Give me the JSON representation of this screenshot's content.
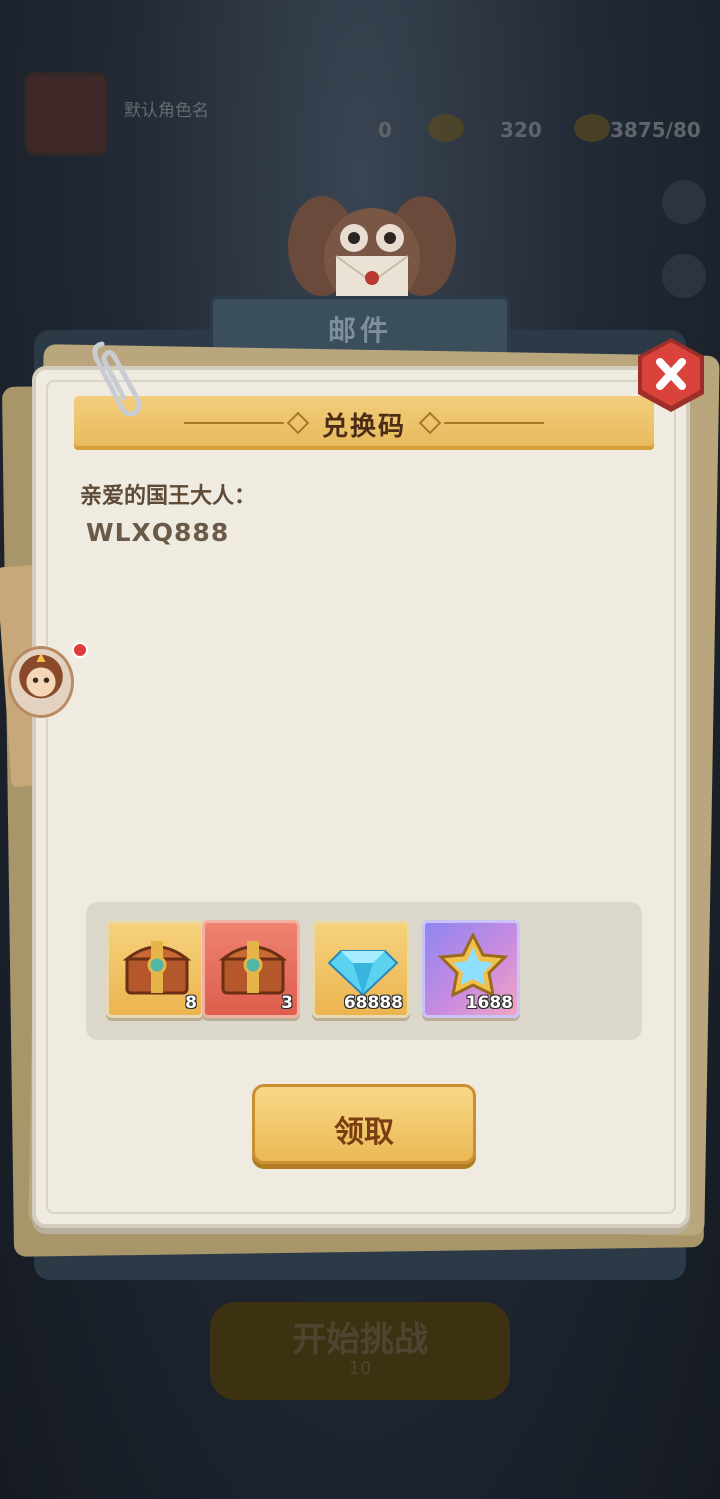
{
  "background": {
    "player_name": "默认角色名",
    "resources": [
      {
        "name": "unknown",
        "value": "0"
      },
      {
        "name": "gold",
        "value": "320"
      },
      {
        "name": "stamina",
        "value": "3875/80"
      }
    ],
    "start_button_label": "开始挑战",
    "start_button_cost": "10"
  },
  "mail": {
    "header_title": "邮件",
    "banner_title": "兑换码",
    "greeting": "亲爱的国王大人：",
    "code": "WLXQ888",
    "rewards": [
      {
        "icon": "treasure-chest-icon",
        "style": "orange",
        "count": "8"
      },
      {
        "icon": "treasure-chest-icon",
        "style": "red",
        "count": "3"
      },
      {
        "icon": "diamond-icon",
        "style": "orange",
        "count": "68888"
      },
      {
        "icon": "star-crystal-icon",
        "style": "purple",
        "count": "1688"
      }
    ],
    "claim_label": "领取"
  },
  "colors": {
    "accent_gold": "#ebb955",
    "close_red": "#d9433b",
    "panel": "#efebe1",
    "text_brown": "#5f4a36"
  }
}
